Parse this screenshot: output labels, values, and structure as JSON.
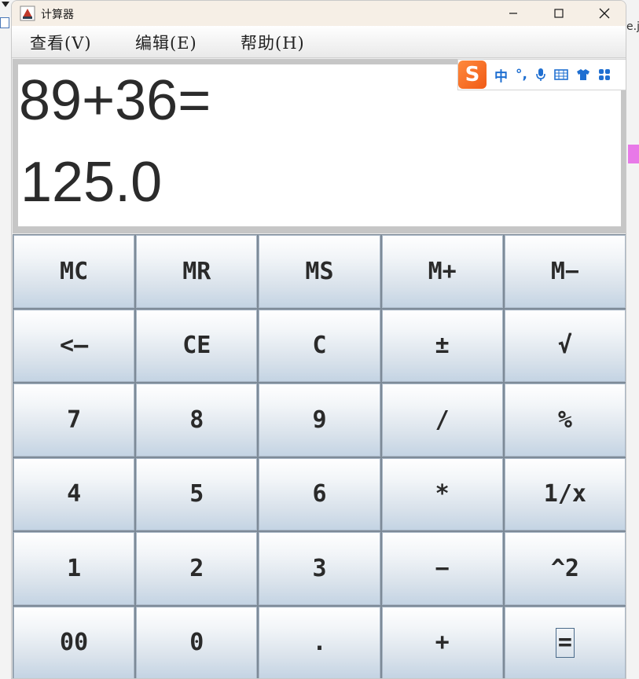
{
  "window": {
    "title": "计算器",
    "icon": "java-app-icon"
  },
  "background": {
    "right_window_text": "e.ja"
  },
  "menu": {
    "view": "查看(V)",
    "edit": "编辑(E)",
    "help": "帮助(H)"
  },
  "display": {
    "expression": "89+36=",
    "result": "125.0"
  },
  "ime": {
    "logo": "S",
    "mode": "中",
    "punct": "°,",
    "icons": [
      "microphone-icon",
      "keyboard-icon",
      "skin-icon",
      "toolbox-icon"
    ]
  },
  "keys": [
    [
      "MC",
      "MR",
      "MS",
      "M+",
      "M−"
    ],
    [
      "<—",
      "CE",
      "C",
      "±",
      "√"
    ],
    [
      "7",
      "8",
      "9",
      "/",
      "%"
    ],
    [
      "4",
      "5",
      "6",
      "*",
      "1/x"
    ],
    [
      "1",
      "2",
      "3",
      "−",
      "^2"
    ],
    [
      "00",
      "0",
      ".",
      "+",
      "="
    ]
  ],
  "colors": {
    "titlebar": "#f6efe6",
    "key_top": "#ffffff",
    "key_bottom": "#c3d3e3",
    "grid_lines": "#7d8a97",
    "ime_accent": "#1f6fd1",
    "ime_logo": "#f05a16"
  }
}
